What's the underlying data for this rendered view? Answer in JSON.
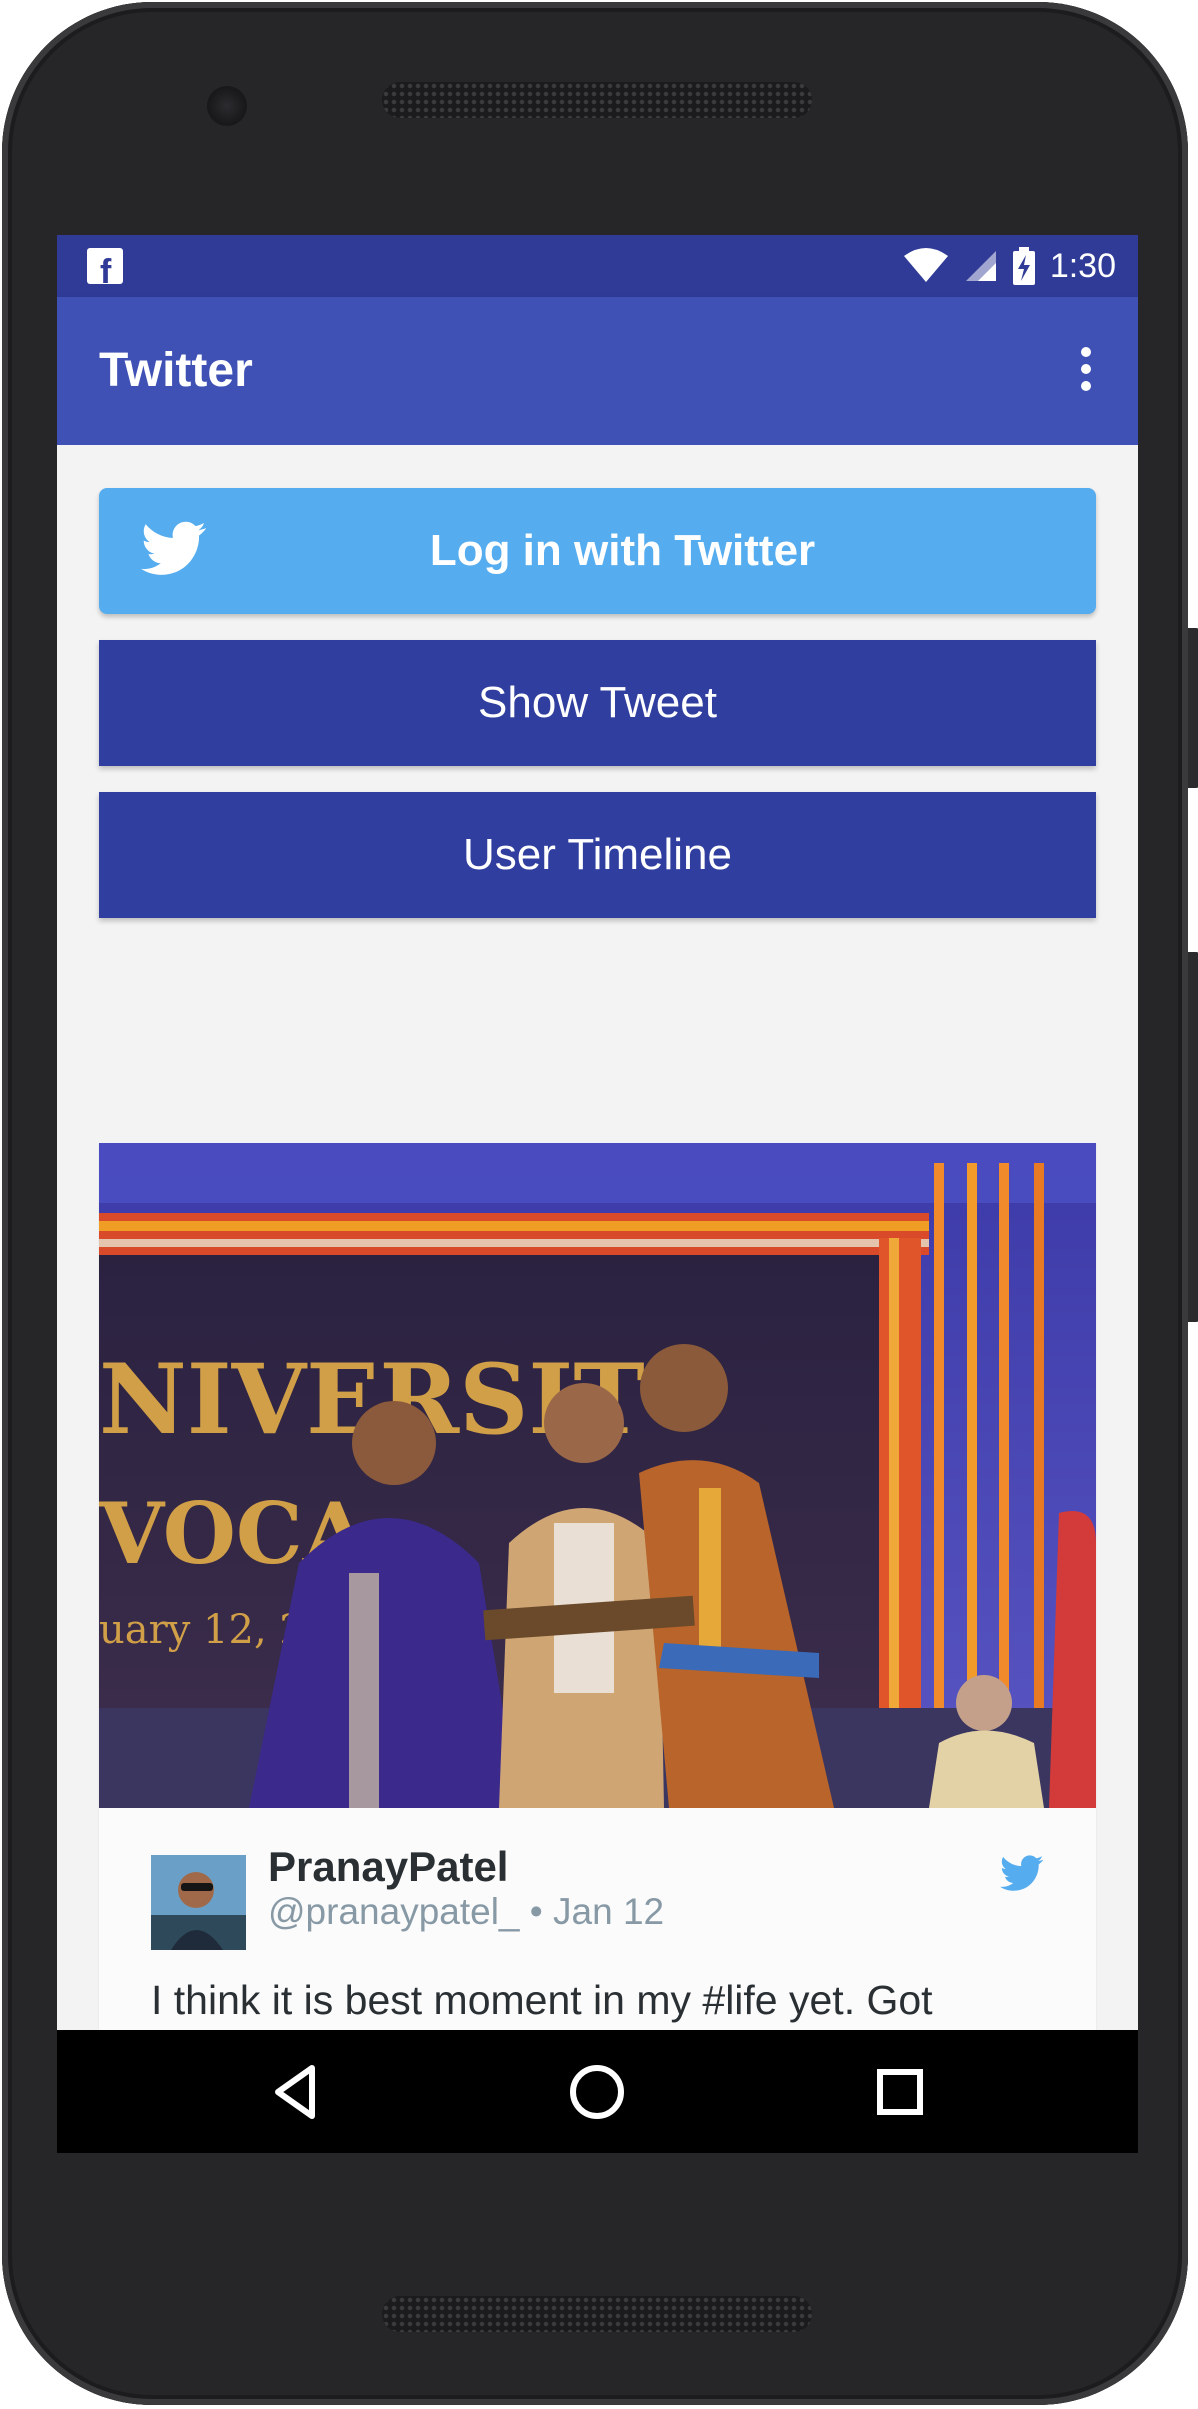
{
  "status_bar": {
    "notification_icon": "facebook-icon",
    "notification_glyph": "f",
    "icons": [
      "wifi-icon",
      "signal-icon",
      "battery-charging-icon"
    ],
    "time": "1:30"
  },
  "app_bar": {
    "title": "Twitter",
    "menu_icon": "more-vert-icon"
  },
  "buttons": {
    "login": "Log in with Twitter",
    "login_icon": "twitter-bird-icon",
    "show_tweet": "Show Tweet",
    "user_timeline": "User Timeline"
  },
  "tweet": {
    "media": "graduation-ceremony-photo",
    "author_name": "PranayPatel",
    "author_meta": "@pranaypatel_ • Jan 12",
    "text": "I think it is best moment in my #life yet. Got\nGold Medal for my Post Graduate.\n #gnuconvocation",
    "brand_icon": "twitter-bird-icon"
  },
  "fab": {
    "icon": "mail-icon"
  },
  "nav_bar": {
    "icons": [
      "back-icon",
      "home-icon",
      "recents-icon"
    ]
  },
  "colors": {
    "status_bar": "#2f3b97",
    "app_bar": "#3f51b5",
    "twitter_blue": "#55acee",
    "primary_button": "#303f9f",
    "fab": "#ff4081",
    "phone_body": "#262628"
  }
}
